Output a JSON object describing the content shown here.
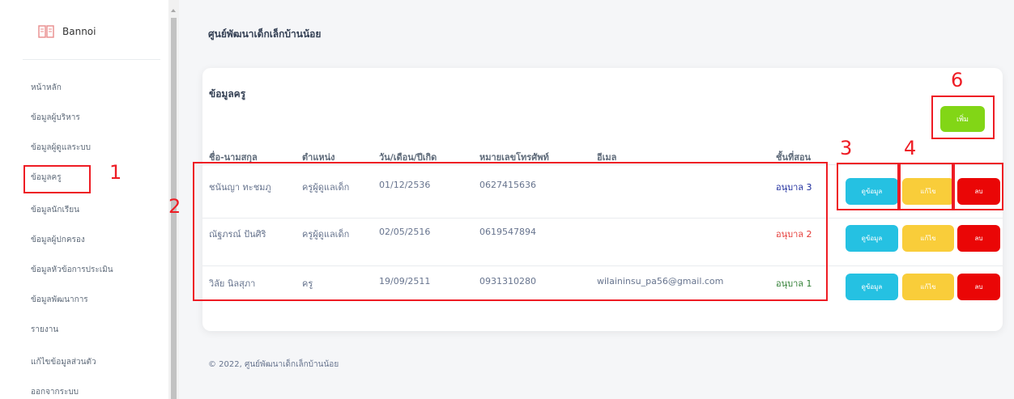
{
  "sidebar": {
    "brand": "Bannoi",
    "items": [
      {
        "label": "หน้าหลัก"
      },
      {
        "label": "ข้อมูลผู้บริหาร"
      },
      {
        "label": "ข้อมูลผู้ดูแลระบบ"
      },
      {
        "label": "ข้อมูลครู"
      },
      {
        "label": "ข้อมูลนักเรียน"
      },
      {
        "label": "ข้อมูลผู้ปกครอง"
      },
      {
        "label": "ข้อมูลหัวข้อการประเมิน"
      },
      {
        "label": "ข้อมูลพัฒนาการ"
      },
      {
        "label": "รายงาน"
      },
      {
        "label": "แก้ไขข้อมูลส่วนตัว"
      },
      {
        "label": "ออกจากระบบ"
      }
    ]
  },
  "header": {
    "title": "ศูนย์พัฒนาเด็กเล็กบ้านน้อย"
  },
  "card": {
    "title": "ข้อมูลครู",
    "add_label": "เพิ่ม",
    "columns": [
      "ชื่อ-นามสกุล",
      "ตำแหน่ง",
      "วัน/เดือน/ปีเกิด",
      "หมายเลขโทรศัพท์",
      "อีเมล",
      "ชั้นที่สอน"
    ],
    "rows": [
      {
        "name": "ชนันญา ทะชมภู",
        "position": "ครูผู้ดูแลเด็ก",
        "dob": "01/12/2536",
        "phone": "0627415636",
        "email": "",
        "grade": "อนุบาล 3",
        "grade_color": "#1b2a9c"
      },
      {
        "name": "ณัฐภรณ์ ปันศิริ",
        "position": "ครูผู้ดูแลเด็ก",
        "dob": "02/05/2516",
        "phone": "0619547894",
        "email": "",
        "grade": "อนุบาล 2",
        "grade_color": "#e53935"
      },
      {
        "name": "วิลัย นิลสุภา",
        "position": "ครู",
        "dob": "19/09/2511",
        "phone": "0931310280",
        "email": "wilaininsu_pa56@gmail.com",
        "grade": "อนุบาล 1",
        "grade_color": "#2e7d32"
      }
    ],
    "actions": {
      "view": "ดูข้อมูล",
      "edit": "แก้ไข",
      "delete": "ลบ"
    }
  },
  "footer": {
    "text": "© 2022, ศูนย์พัฒนาเด็กเล็กบ้านน้อย"
  },
  "annotations": [
    "1",
    "2",
    "3",
    "4",
    "6"
  ],
  "colors": {
    "add": "#82d616",
    "view": "#25c1e2",
    "edit": "#f9cd3a",
    "delete": "#ea0606",
    "annotation": "#ee1c24"
  }
}
